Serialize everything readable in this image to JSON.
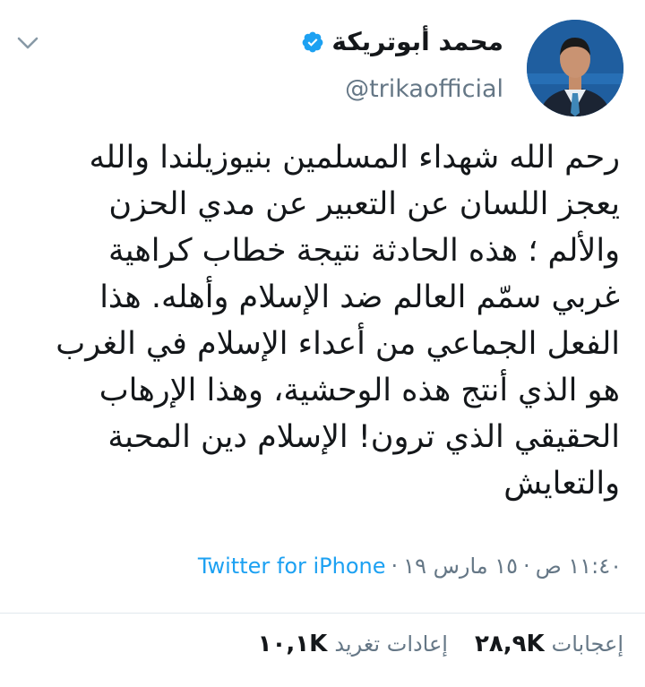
{
  "author": {
    "display_name": "محمد أبوتريكة",
    "handle": "@trikaofficial",
    "verified": true
  },
  "icons": {
    "verified": "verified-badge-icon",
    "caret": "chevron-down-icon"
  },
  "tweet": {
    "text": "رحم الله شهداء المسلمين بنيوزيلندا والله\nيعجز اللسان عن التعبير عن مدي الحزن\nوالألم ؛ هذه الحادثة نتيجة خطاب كراهية\nغربي سمّم العالم ضد الإسلام وأهله. هذا\nالفعل الجماعي من أعداء الإسلام في الغرب\nهو الذي أنتج هذه الوحشية، وهذا الإرهاب\nالحقيقي الذي ترون! الإسلام دين المحبة\nوالتعايش",
    "time": "١١:٤٠ ص",
    "date": "١٥ مارس ١٩",
    "separator": "·",
    "source": "Twitter for iPhone"
  },
  "stats": {
    "retweets_count": "١٠,١K",
    "retweets_label": "إعادات تغريد",
    "likes_count": "٢٨,٩K",
    "likes_label": "إعجابات"
  },
  "colors": {
    "link": "#1da1f2",
    "muted": "#657786",
    "text": "#14171a",
    "divider": "#e1e8ed"
  }
}
